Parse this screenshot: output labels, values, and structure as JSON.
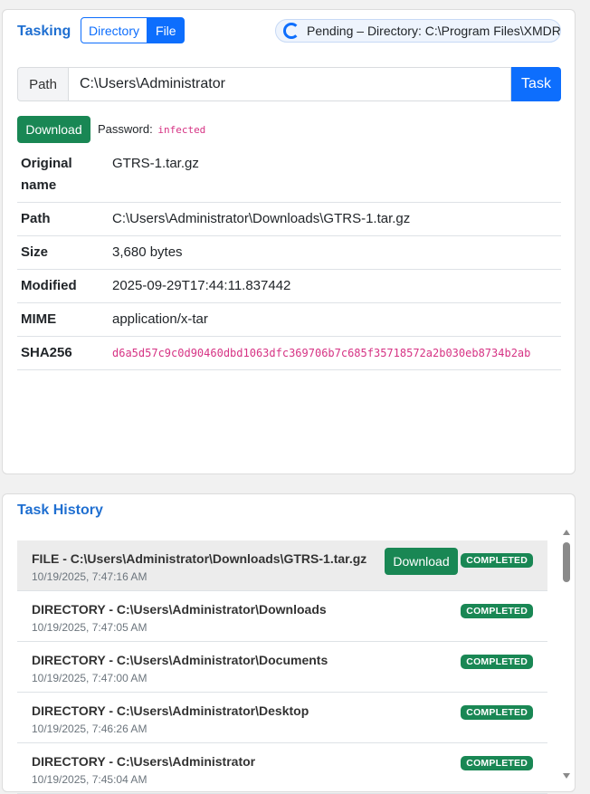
{
  "tasking": {
    "title": "Tasking",
    "mode_directory": "Directory",
    "mode_file": "File",
    "pending": "Pending – Directory: C:\\Program Files\\XMDR",
    "path_label": "Path",
    "path_value": "C:\\Users\\Administrator",
    "task_button": "Task",
    "download_button": "Download",
    "password_label": "Password:",
    "password_value": "infected",
    "meta": {
      "original_name_key": "Original name",
      "original_name": "GTRS-1.tar.gz",
      "path_key": "Path",
      "path": "C:\\Users\\Administrator\\Downloads\\GTRS-1.tar.gz",
      "size_key": "Size",
      "size": "3,680 bytes",
      "modified_key": "Modified",
      "modified": "2025-09-29T17:44:11.837442",
      "mime_key": "MIME",
      "mime": "application/x-tar",
      "sha256_key": "SHA256",
      "sha256": "d6a5d57c9c0d90460dbd1063dfc369706b7c685f35718572a2b030eb8734b2ab"
    }
  },
  "history": {
    "title": "Task History",
    "items": [
      {
        "title": "FILE - C:\\Users\\Administrator\\Downloads\\GTRS-1.tar.gz",
        "time": "10/19/2025, 7:47:16 AM",
        "status": "COMPLETED",
        "download": "Download"
      },
      {
        "title": "DIRECTORY - C:\\Users\\Administrator\\Downloads",
        "time": "10/19/2025, 7:47:05 AM",
        "status": "COMPLETED"
      },
      {
        "title": "DIRECTORY - C:\\Users\\Administrator\\Documents",
        "time": "10/19/2025, 7:47:00 AM",
        "status": "COMPLETED"
      },
      {
        "title": "DIRECTORY - C:\\Users\\Administrator\\Desktop",
        "time": "10/19/2025, 7:46:26 AM",
        "status": "COMPLETED"
      },
      {
        "title": "DIRECTORY - C:\\Users\\Administrator",
        "time": "10/19/2025, 7:45:04 AM",
        "status": "COMPLETED"
      }
    ]
  },
  "colors": {
    "primary": "#0d6efd",
    "success": "#198754",
    "title": "#1f6fd1",
    "code": "#d63384"
  }
}
